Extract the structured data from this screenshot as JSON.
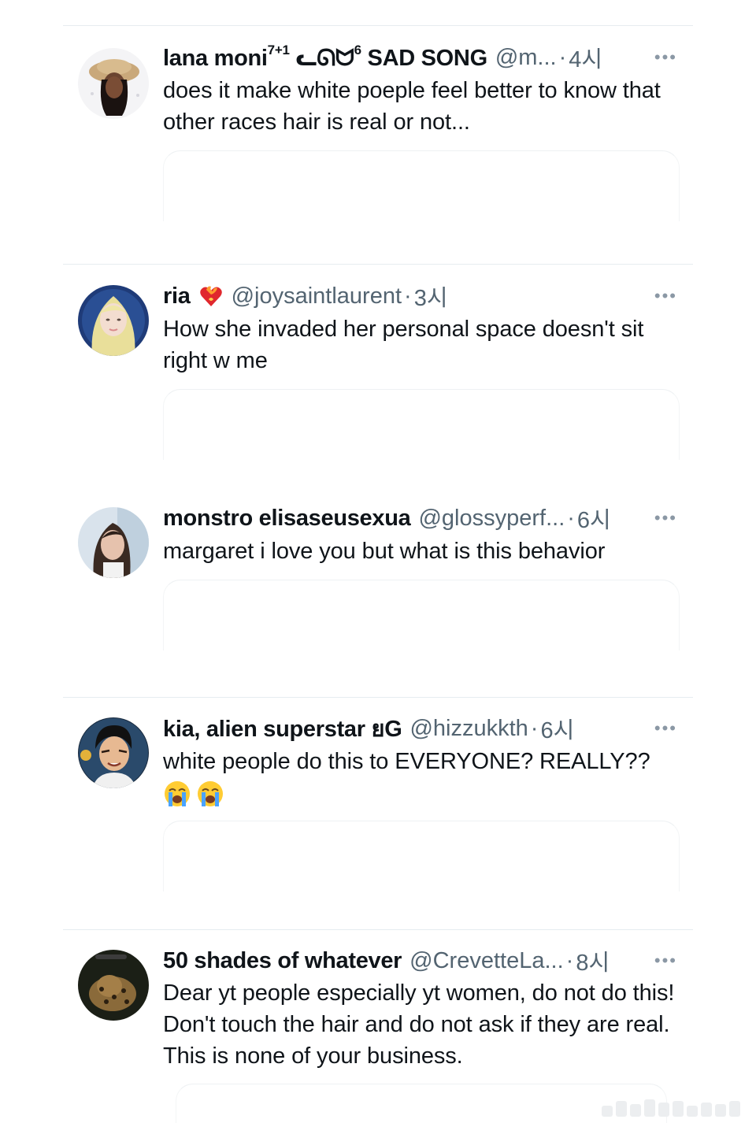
{
  "tweets": [
    {
      "display_name": "lana moni",
      "display_name_sup": "7+1",
      "display_name_rest": " ᓚᘏᗢ",
      "display_name_sup2": "6",
      "display_name_tail": " SAD SONG",
      "handle": "@m...",
      "time": "4시",
      "more": "•••",
      "body": "does it make white poeple feel better to know that other races hair is real or not...",
      "avatar": "cartoon-girl-hat-avatar"
    },
    {
      "display_name": "ria",
      "badge": "heart-fire-icon",
      "handle": "@joysaintlaurent",
      "time": "3시",
      "more": "•••",
      "body": "How she invaded her personal space doesn't sit right w me",
      "avatar": "blonde-girl-avatar"
    },
    {
      "display_name": "monstro elisaseusexua",
      "handle": "@glossyperf...",
      "time": "6시",
      "more": "•••",
      "body": "margaret i love you but what is this behavior",
      "avatar": "brunette-woman-avatar"
    },
    {
      "display_name": "kia, alien superstar ยG",
      "handle": "@hizzukkth",
      "time": "6시",
      "more": "•••",
      "body": "white people do this to EVERYONE? REALLY??",
      "emojis": [
        "loudly-crying-face-icon",
        "loudly-crying-face-icon"
      ],
      "avatar": "cartoon-man-avatar"
    },
    {
      "display_name": "50 shades of whatever",
      "handle": "@CrevetteLa...",
      "time": "8시",
      "more": "•••",
      "body": "Dear yt people especially yt women, do not do this! Don't touch the hair and do not ask if they are real.  This is none of your business.",
      "avatar": "leopard-avatar"
    }
  ],
  "separator": "·"
}
